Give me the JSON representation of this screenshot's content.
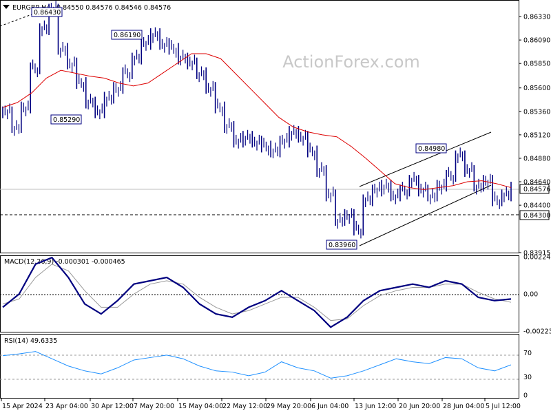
{
  "header": {
    "symbol": "EURGBP,H4",
    "ohlc": "0.84550 0.84576 0.84546 0.84576",
    "watermark": "ActionForex.com"
  },
  "chart_data": [
    {
      "type": "candlestick",
      "panel": "price",
      "ylim": [
        0.83915,
        0.8645
      ],
      "y_ticks": [
        "0.86330",
        "0.86090",
        "0.85850",
        "0.85600",
        "0.85360",
        "0.85120",
        "0.84880",
        "0.84640",
        "0.84400",
        "0.83915"
      ],
      "last_price": "0.84576",
      "level_line": "0.84300",
      "annotations": [
        {
          "label": "0.86430",
          "value": 0.8643,
          "date": "22 Apr 2024"
        },
        {
          "label": "0.86190",
          "value": 0.8619,
          "date": "10 May 2024"
        },
        {
          "label": "0.85290",
          "value": 0.8529,
          "date": "26 Apr 2024"
        },
        {
          "label": "0.84980",
          "value": 0.8498,
          "date": "28 Jun 2024"
        },
        {
          "label": "0.83960",
          "value": 0.8396,
          "date": "13 Jun 2024"
        }
      ],
      "series": [
        {
          "name": "EURGBP",
          "values": [
            0.8535,
            0.852,
            0.854,
            0.858,
            0.862,
            0.864,
            0.86,
            0.8585,
            0.8565,
            0.8545,
            0.8535,
            0.855,
            0.856,
            0.8575,
            0.859,
            0.8605,
            0.8615,
            0.8605,
            0.86,
            0.859,
            0.8585,
            0.8575,
            0.856,
            0.854,
            0.852,
            0.8505,
            0.851,
            0.8505,
            0.85,
            0.8495,
            0.8505,
            0.8515,
            0.851,
            0.8495,
            0.8475,
            0.845,
            0.8425,
            0.843,
            0.8415,
            0.8445,
            0.8455,
            0.846,
            0.845,
            0.8455,
            0.8465,
            0.8455,
            0.845,
            0.846,
            0.847,
            0.849,
            0.8475,
            0.846,
            0.8465,
            0.8445,
            0.845,
            0.8458
          ]
        },
        {
          "name": "MA",
          "values": [
            0.854,
            0.8545,
            0.8555,
            0.857,
            0.8578,
            0.8575,
            0.8572,
            0.857,
            0.8565,
            0.8562,
            0.8565,
            0.8575,
            0.8585,
            0.8595,
            0.8595,
            0.859,
            0.8575,
            0.856,
            0.8545,
            0.853,
            0.852,
            0.8515,
            0.8512,
            0.851,
            0.85,
            0.8488,
            0.8475,
            0.8462,
            0.8458,
            0.8456,
            0.8458,
            0.846,
            0.8464,
            0.8465,
            0.8462,
            0.8458
          ]
        }
      ]
    },
    {
      "type": "line",
      "panel": "MACD",
      "label": "MACD(12,26,9) -0.000301 -0.000465",
      "ylim": [
        -0.002236,
        0.002248
      ],
      "y_ticks": [
        "0.002248",
        "0.00",
        "-0.002236"
      ],
      "series": [
        {
          "name": "MACD",
          "values": [
            -0.0008,
            0.0,
            0.0018,
            0.0022,
            0.001,
            -0.0006,
            -0.0012,
            -0.0004,
            0.0006,
            0.0008,
            0.001,
            0.0004,
            -0.0006,
            -0.0012,
            -0.0014,
            -0.0008,
            -0.0004,
            0.0002,
            -0.0004,
            -0.001,
            -0.002,
            -0.0014,
            -0.0004,
            0.0002,
            0.0004,
            0.0006,
            0.0004,
            0.0008,
            0.0006,
            -0.0002,
            -0.0004,
            -0.0003
          ]
        },
        {
          "name": "Signal",
          "values": [
            -0.0006,
            -0.0003,
            0.001,
            0.0018,
            0.0014,
            0.0002,
            -0.0008,
            -0.0008,
            0.0,
            0.0006,
            0.0008,
            0.0006,
            -0.0002,
            -0.0008,
            -0.0012,
            -0.001,
            -0.0006,
            -0.0002,
            -0.0002,
            -0.0008,
            -0.0016,
            -0.0015,
            -0.0007,
            -0.0001,
            0.0002,
            0.0004,
            0.0004,
            0.0006,
            0.0006,
            0.0001,
            -0.0003,
            -0.0005
          ]
        }
      ]
    },
    {
      "type": "line",
      "panel": "RSI",
      "label": "RSI(14) 49.6335",
      "ylim": [
        0,
        100
      ],
      "y_ticks": [
        "70",
        "30",
        "0"
      ],
      "series": [
        {
          "name": "RSI",
          "values": [
            65,
            68,
            72,
            60,
            48,
            40,
            35,
            45,
            58,
            62,
            66,
            60,
            48,
            40,
            38,
            32,
            38,
            55,
            45,
            40,
            28,
            32,
            40,
            50,
            60,
            55,
            52,
            62,
            60,
            45,
            40,
            50
          ]
        }
      ]
    }
  ],
  "x_axis_labels": [
    "15 Apr 2024",
    "23 Apr 04:00",
    "30 Apr 12:00",
    "7 May 20:00",
    "15 May 04:00",
    "22 May 12:00",
    "29 May 20:00",
    "6 Jun 04:00",
    "13 Jun 12:00",
    "20 Jun 20:00",
    "28 Jun 04:00",
    "5 Jul 12:00"
  ],
  "colors": {
    "bull": "#000080",
    "ma": "#dd0000",
    "macd": "#000080",
    "signal": "#999999",
    "rsi": "#1e90ff",
    "channel": "#000000",
    "grid": "#000000"
  }
}
